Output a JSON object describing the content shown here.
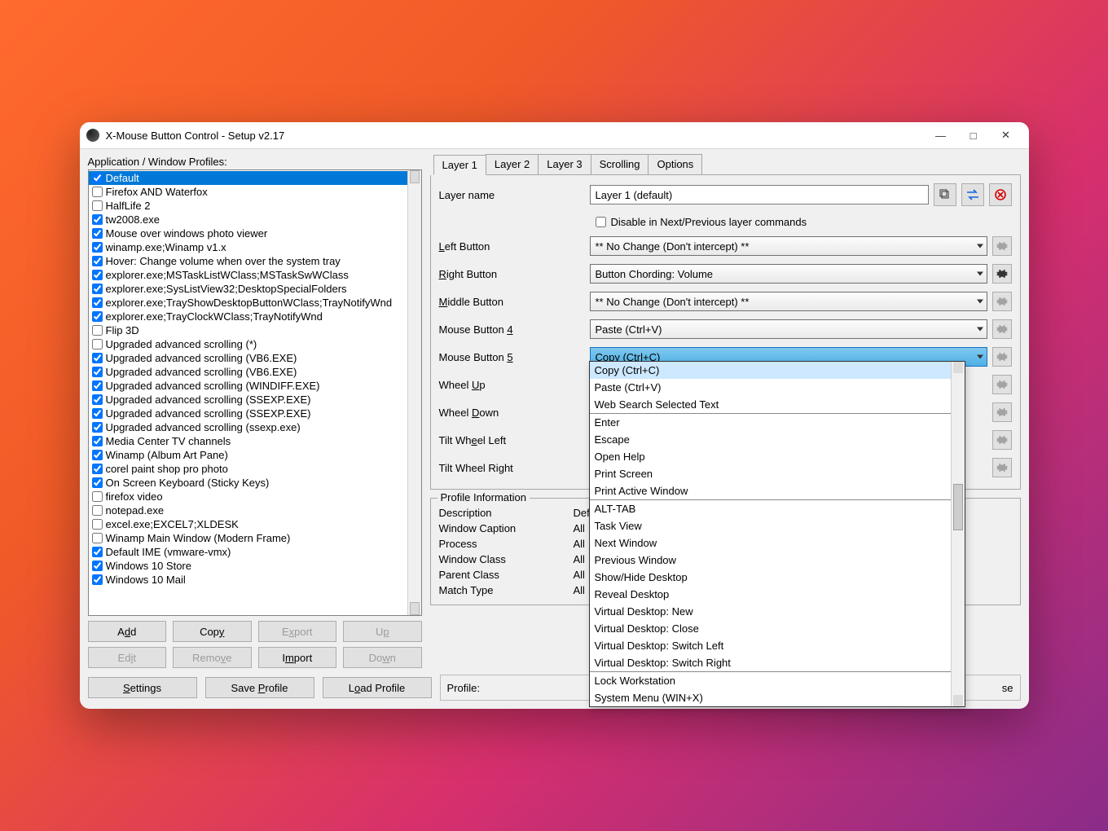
{
  "title": "X-Mouse Button Control - Setup v2.17",
  "profiles_label": "Application / Window Profiles:",
  "profiles": [
    {
      "label": "Default",
      "checked": true,
      "selected": true
    },
    {
      "label": "Firefox AND Waterfox",
      "checked": false
    },
    {
      "label": "HalfLife 2",
      "checked": false
    },
    {
      "label": "tw2008.exe",
      "checked": true
    },
    {
      "label": "Mouse over windows photo viewer",
      "checked": true
    },
    {
      "label": "winamp.exe;Winamp v1.x",
      "checked": true
    },
    {
      "label": "Hover: Change volume when over the system tray",
      "checked": true
    },
    {
      "label": "explorer.exe;MSTaskListWClass;MSTaskSwWClass",
      "checked": true
    },
    {
      "label": "explorer.exe;SysListView32;DesktopSpecialFolders",
      "checked": true
    },
    {
      "label": "explorer.exe;TrayShowDesktopButtonWClass;TrayNotifyWnd",
      "checked": true
    },
    {
      "label": "explorer.exe;TrayClockWClass;TrayNotifyWnd",
      "checked": true
    },
    {
      "label": "Flip 3D",
      "checked": false
    },
    {
      "label": "Upgraded advanced scrolling (*)",
      "checked": false
    },
    {
      "label": "Upgraded advanced scrolling (VB6.EXE)",
      "checked": true
    },
    {
      "label": "Upgraded advanced scrolling (VB6.EXE)",
      "checked": true
    },
    {
      "label": "Upgraded advanced scrolling (WINDIFF.EXE)",
      "checked": true
    },
    {
      "label": "Upgraded advanced scrolling (SSEXP.EXE)",
      "checked": true
    },
    {
      "label": "Upgraded advanced scrolling (SSEXP.EXE)",
      "checked": true
    },
    {
      "label": "Upgraded advanced scrolling (ssexp.exe)",
      "checked": true
    },
    {
      "label": "Media Center TV channels",
      "checked": true
    },
    {
      "label": "Winamp (Album Art Pane)",
      "checked": true
    },
    {
      "label": "corel paint shop pro photo",
      "checked": true
    },
    {
      "label": "On Screen Keyboard (Sticky Keys)",
      "checked": true
    },
    {
      "label": "firefox video",
      "checked": false
    },
    {
      "label": "notepad.exe",
      "checked": false
    },
    {
      "label": "excel.exe;EXCEL7;XLDESK",
      "checked": false
    },
    {
      "label": "Winamp Main Window (Modern Frame)",
      "checked": false
    },
    {
      "label": "Default IME (vmware-vmx)",
      "checked": true
    },
    {
      "label": "Windows 10 Store",
      "checked": true
    },
    {
      "label": "Windows 10 Mail",
      "checked": true
    }
  ],
  "buttons": {
    "add": "Add",
    "copy": "Copy",
    "export": "Export",
    "up": "Up",
    "edit": "Edit",
    "remove": "Remove",
    "import": "Import",
    "down": "Down"
  },
  "tabs": [
    "Layer 1",
    "Layer 2",
    "Layer 3",
    "Scrolling",
    "Options"
  ],
  "layer_name_label": "Layer name",
  "layer_name_value": "Layer 1 (default)",
  "disable_checkbox": "Disable in Next/Previous layer commands",
  "fields": [
    {
      "label": "Left Button",
      "value": "** No Change (Don't intercept) **",
      "gear": "dim"
    },
    {
      "label": "Right Button",
      "value": "Button Chording: Volume",
      "gear": "on"
    },
    {
      "label": "Middle Button",
      "value": "** No Change (Don't intercept) **",
      "gear": "dim"
    },
    {
      "label": "Mouse Button 4",
      "value": "Paste (Ctrl+V)",
      "gear": "dim"
    },
    {
      "label": "Mouse Button 5",
      "value": "Copy (Ctrl+C)",
      "gear": "dim",
      "active": true
    },
    {
      "label": "Wheel Up",
      "value": "",
      "gear": "dim"
    },
    {
      "label": "Wheel Down",
      "value": "",
      "gear": "dim"
    },
    {
      "label": "Tilt Wheel Left",
      "value": "",
      "gear": "dim"
    },
    {
      "label": "Tilt Wheel Right",
      "value": "",
      "gear": "dim"
    }
  ],
  "dropdown_options": [
    {
      "label": "Copy (Ctrl+C)",
      "hov": true
    },
    {
      "label": "Paste (Ctrl+V)"
    },
    {
      "label": "Web Search Selected Text",
      "sep": true
    },
    {
      "label": "Enter"
    },
    {
      "label": "Escape"
    },
    {
      "label": "Open Help"
    },
    {
      "label": "Print Screen"
    },
    {
      "label": "Print Active Window",
      "sep": true
    },
    {
      "label": "ALT-TAB"
    },
    {
      "label": "Task View"
    },
    {
      "label": "Next Window"
    },
    {
      "label": "Previous Window"
    },
    {
      "label": "Show/Hide Desktop"
    },
    {
      "label": "Reveal Desktop"
    },
    {
      "label": "Virtual Desktop: New"
    },
    {
      "label": "Virtual Desktop: Close"
    },
    {
      "label": "Virtual Desktop: Switch Left"
    },
    {
      "label": "Virtual Desktop: Switch Right",
      "sep": true
    },
    {
      "label": "Lock Workstation"
    },
    {
      "label": "System Menu (WIN+X)"
    }
  ],
  "profile_info": {
    "legend": "Profile Information",
    "rows": [
      {
        "l": "Description",
        "v": "Defa"
      },
      {
        "l": "Window Caption",
        "v": "All"
      },
      {
        "l": "Process",
        "v": "All"
      },
      {
        "l": "Window Class",
        "v": "All"
      },
      {
        "l": "Parent Class",
        "v": "All"
      },
      {
        "l": "Match Type",
        "v": "All"
      }
    ]
  },
  "bottom": {
    "settings": "Settings",
    "save": "Save Profile",
    "load": "Load Profile",
    "profile_label": "Profile:",
    "close_tail": "se"
  }
}
